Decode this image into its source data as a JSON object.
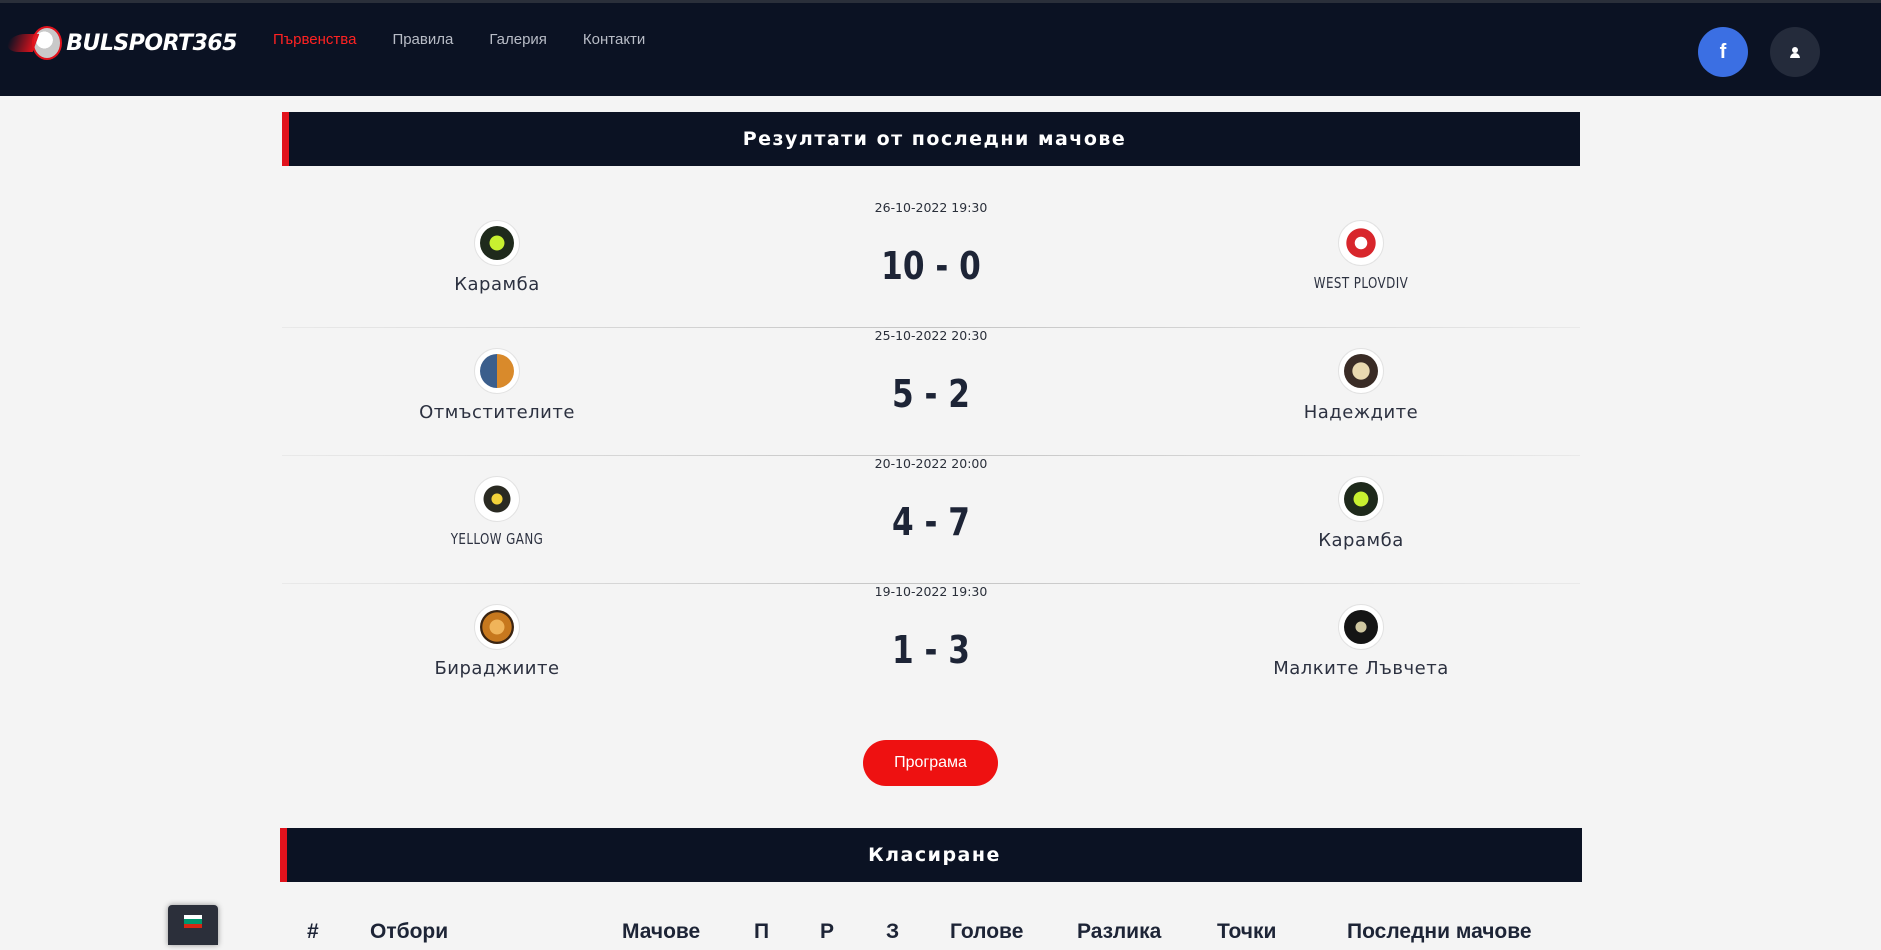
{
  "header": {
    "logo_text": "BULSPORT365",
    "nav": [
      {
        "label": "Първенства",
        "active": true
      },
      {
        "label": "Правила",
        "active": false
      },
      {
        "label": "Галерия",
        "active": false
      },
      {
        "label": "Контакти",
        "active": false
      }
    ],
    "facebook_glyph": "f",
    "facebook_icon": "facebook-icon",
    "user_icon": "user-icon"
  },
  "results": {
    "title": "Резултати от последни мачове",
    "matches": [
      {
        "date": "26-10-2022 19:30",
        "home": "Карамба",
        "away": "WEST PLOVDIV",
        "score": "10 - 0",
        "home_color": "#1f2a1c",
        "away_color": "#d8262c"
      },
      {
        "date": "25-10-2022 20:30",
        "home": "Отмъстителите",
        "away": "Надеждите",
        "score": "5 - 2",
        "home_color": "#d98a2b",
        "away_color": "#3a2c26"
      },
      {
        "date": "20-10-2022 20:00",
        "home": "YELLOW GANG",
        "away": "Карамба",
        "score": "4 - 7",
        "home_color": "#2a2a22",
        "away_color": "#1f2a1c"
      },
      {
        "date": "19-10-2022 19:30",
        "home": "Бираджиите",
        "away": "Малките Лъвчета",
        "score": "1 - 3",
        "home_color": "#c7781e",
        "away_color": "#151515"
      }
    ],
    "program_button": "Програма"
  },
  "standings": {
    "title": "Класиране",
    "columns": [
      "#",
      "Отбори",
      "Мачове",
      "П",
      "Р",
      "З",
      "Голове",
      "Разлика",
      "Точки",
      "Последни мачове"
    ]
  },
  "language": {
    "flag_colors": [
      "#ffffff",
      "#00966e",
      "#d62612"
    ],
    "flag_icon": "bulgaria-flag-icon"
  }
}
